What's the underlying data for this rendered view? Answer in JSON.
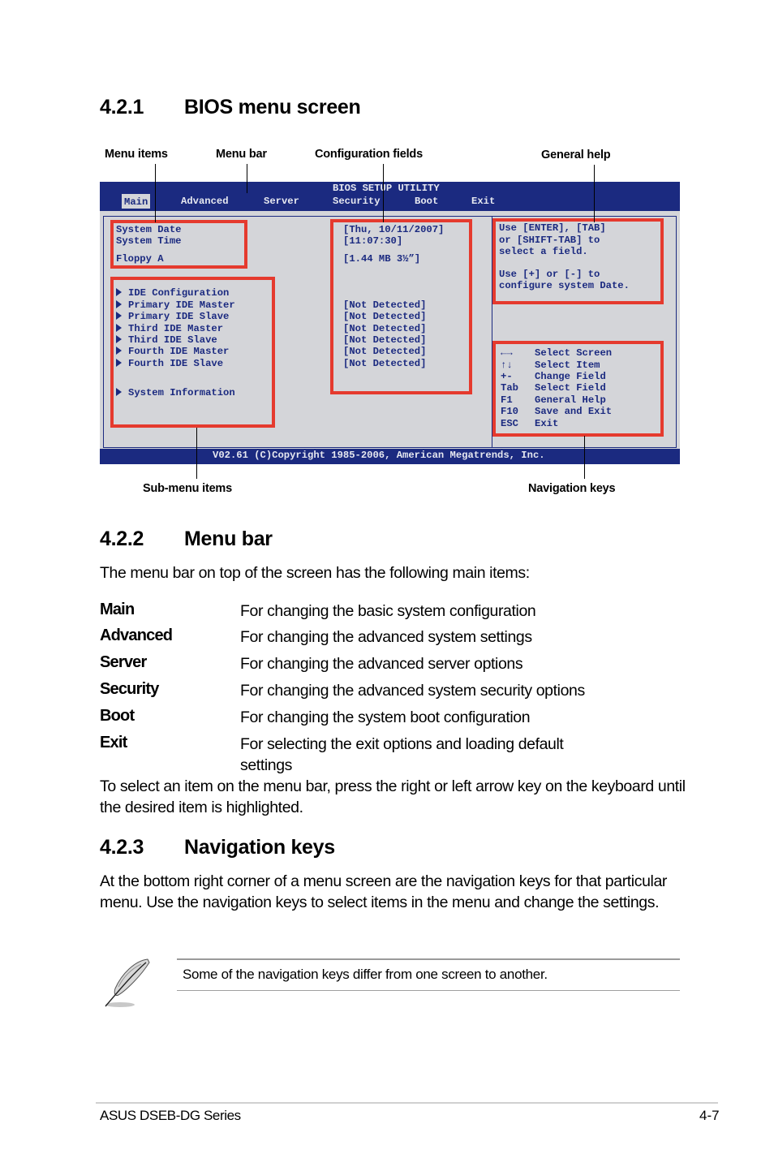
{
  "section_421": {
    "number": "4.2.1",
    "title": "BIOS menu screen"
  },
  "callouts": {
    "menu_items": "Menu items",
    "menu_bar": "Menu bar",
    "configuration_fields": "Configuration fields",
    "general_help": "General help",
    "sub_menu_items": "Sub-menu items",
    "navigation_keys": "Navigation keys"
  },
  "bios": {
    "title": "BIOS SETUP UTILITY",
    "menu": [
      "Main",
      "Advanced",
      "Server",
      "Security",
      "Boot",
      "Exit"
    ],
    "active_menu": "Main",
    "items": [
      "System Date",
      "System Time",
      "Floppy A"
    ],
    "item_values": [
      "[Thu, 10/11/2007]",
      "[11:07:30]",
      "[1.44 MB 3½”]"
    ],
    "submenus": [
      "IDE Configuration",
      "Primary IDE Master",
      "Primary IDE Slave",
      "Third IDE Master",
      "Third IDE Slave",
      "Fourth IDE Master",
      "Fourth IDE Slave",
      "System Information"
    ],
    "submenu_values": [
      "[Not Detected]",
      "[Not Detected]",
      "[Not Detected]",
      "[Not Detected]",
      "[Not Detected]",
      "[Not Detected]"
    ],
    "help_lines": [
      "Use [ENTER], [TAB]",
      "or [SHIFT-TAB] to",
      "select a field.",
      "Use [+] or [-] to",
      "configure system Date."
    ],
    "nav_keys": [
      {
        "key": "←→",
        "action": "Select Screen"
      },
      {
        "key": "↑↓",
        "action": "Select Item"
      },
      {
        "key": "+-",
        "action": "Change Field"
      },
      {
        "key": "Tab",
        "action": "Select Field"
      },
      {
        "key": "F1",
        "action": "General Help"
      },
      {
        "key": "F10",
        "action": "Save and Exit"
      },
      {
        "key": "ESC",
        "action": "Exit"
      }
    ],
    "copyright": "V02.61 (C)Copyright 1985-2006, American Megatrends, Inc.",
    "colors": {
      "bar": "#1b2a80",
      "background": "#d4d5d9",
      "highlight_box": "#e53a2e"
    }
  },
  "section_422": {
    "number": "4.2.2",
    "title": "Menu bar",
    "intro": "The menu bar on top of the screen has the following main items:",
    "definitions": [
      {
        "term": "Main",
        "desc": "For changing the basic system configuration"
      },
      {
        "term": "Advanced",
        "desc": "For changing the advanced system settings"
      },
      {
        "term": "Server",
        "desc": "For changing the advanced server options"
      },
      {
        "term": "Security",
        "desc": "For changing the advanced system security options"
      },
      {
        "term": "Boot",
        "desc": "For changing the system boot configuration"
      },
      {
        "term": "Exit",
        "desc": "For selecting the exit options and loading default settings"
      }
    ],
    "outro": "To select an item on the menu bar, press the right or left arrow key on the keyboard until the desired item is highlighted."
  },
  "section_423": {
    "number": "4.2.3",
    "title": "Navigation keys",
    "body": "At the bottom right corner of a menu screen are the navigation keys for that particular menu. Use the navigation keys to select items in the menu and change the settings."
  },
  "note": {
    "icon": "feather-pen-icon",
    "text": "Some of the navigation keys differ from one screen to another."
  },
  "footer": {
    "left": "ASUS DSEB-DG Series",
    "right": "4-7"
  }
}
